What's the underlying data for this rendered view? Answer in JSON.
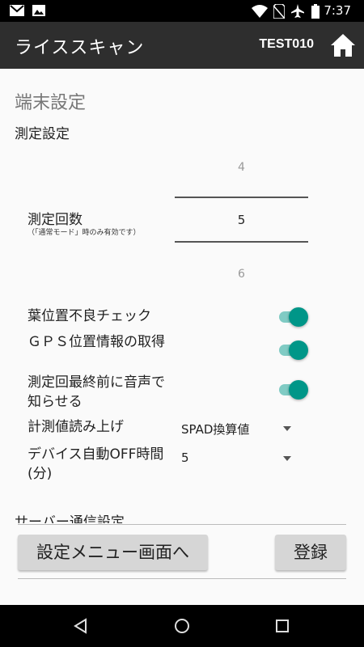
{
  "status_bar": {
    "time": "7:37",
    "icons": [
      "gmail-icon",
      "image-icon",
      "wifi-icon",
      "no-sim-icon",
      "airplane-icon",
      "battery-icon"
    ]
  },
  "app_bar": {
    "title": "ライススキャン",
    "user": "TEST010",
    "home_icon": "home-icon"
  },
  "page": {
    "section_title": "端末設定",
    "measurement_settings": "測定設定",
    "count": {
      "label": "測定回数",
      "note": "（「通常モード」時のみ有効です）",
      "prev": "4",
      "current": "5",
      "next": "6"
    },
    "settings": [
      {
        "label": "葉位置不良チェック",
        "on": true
      },
      {
        "label": "ＧＰＳ位置情報の取得",
        "on": true
      },
      {
        "label": "測定回最終前に音声で知らせる",
        "on": true
      }
    ],
    "readout": {
      "label": "計測値読み上げ",
      "value": "SPAD換算値"
    },
    "auto_off": {
      "label": "デバイス自動OFF時間(分)",
      "value": "5"
    },
    "server_settings": "サーバー通信設定"
  },
  "buttons": {
    "settings_menu": "設定メニュー画面へ",
    "register": "登録"
  },
  "colors": {
    "accent": "#009688",
    "accent_track": "#80cbc4",
    "app_bar": "#2e2e2e"
  }
}
